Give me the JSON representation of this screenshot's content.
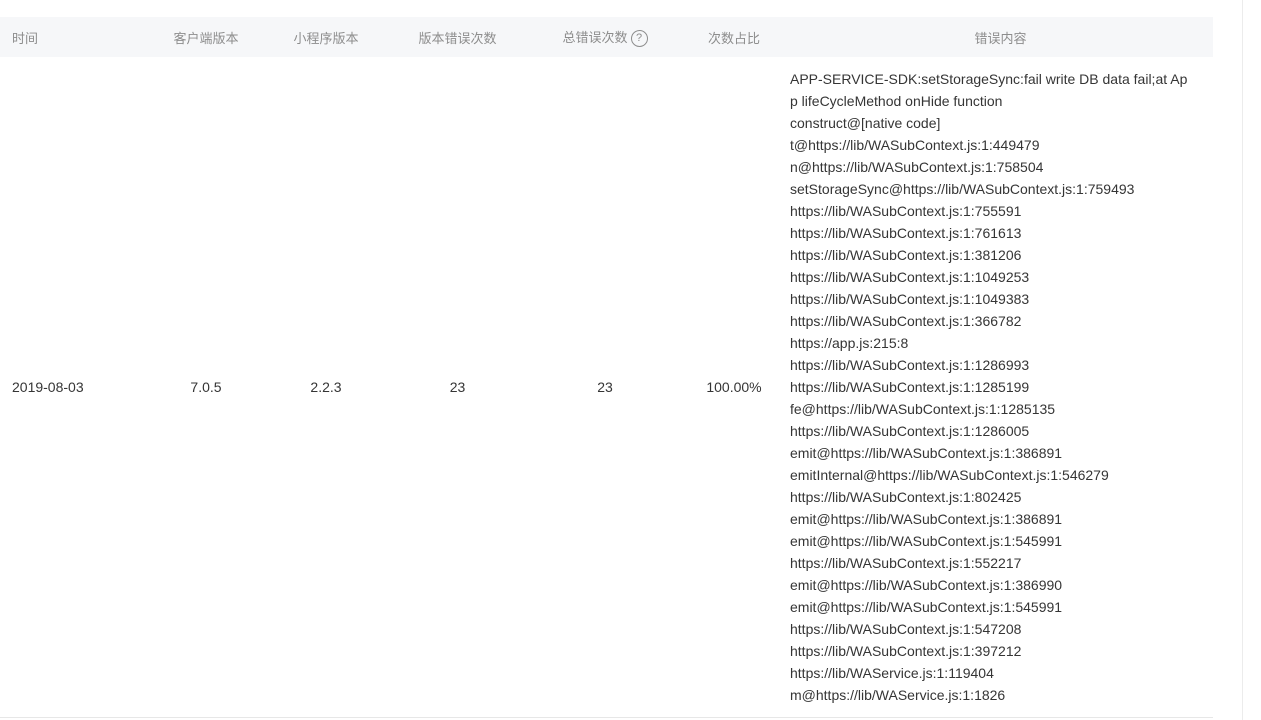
{
  "table": {
    "headers": {
      "time": "时间",
      "client_version": "客户端版本",
      "miniprogram_version": "小程序版本",
      "version_error_count": "版本错误次数",
      "total_error_count": "总错误次数",
      "ratio": "次数占比",
      "error_content": "错误内容"
    },
    "help_icon": "?",
    "row": {
      "time": "2019-08-03",
      "client_version": "7.0.5",
      "miniprogram_version": "2.2.3",
      "version_error_count": "23",
      "total_error_count": "23",
      "ratio": "100.00%",
      "error_lines": [
        "APP-SERVICE-SDK:setStorageSync:fail write DB data fail;at App lifeCycleMethod onHide function",
        "construct@[native code]",
        "t@https://lib/WASubContext.js:1:449479",
        "n@https://lib/WASubContext.js:1:758504",
        "setStorageSync@https://lib/WASubContext.js:1:759493",
        "https://lib/WASubContext.js:1:755591",
        "https://lib/WASubContext.js:1:761613",
        "https://lib/WASubContext.js:1:381206",
        "https://lib/WASubContext.js:1:1049253",
        "https://lib/WASubContext.js:1:1049383",
        "https://lib/WASubContext.js:1:366782",
        "https://app.js:215:8",
        "https://lib/WASubContext.js:1:1286993",
        "https://lib/WASubContext.js:1:1285199",
        "fe@https://lib/WASubContext.js:1:1285135",
        "https://lib/WASubContext.js:1:1286005",
        "emit@https://lib/WASubContext.js:1:386891",
        "emitInternal@https://lib/WASubContext.js:1:546279",
        "https://lib/WASubContext.js:1:802425",
        "emit@https://lib/WASubContext.js:1:386891",
        "emit@https://lib/WASubContext.js:1:545991",
        "https://lib/WASubContext.js:1:552217",
        "emit@https://lib/WASubContext.js:1:386990",
        "emit@https://lib/WASubContext.js:1:545991",
        "https://lib/WASubContext.js:1:547208",
        "https://lib/WASubContext.js:1:397212",
        "https://lib/WAService.js:1:119404",
        "m@https://lib/WAService.js:1:1826"
      ]
    }
  }
}
